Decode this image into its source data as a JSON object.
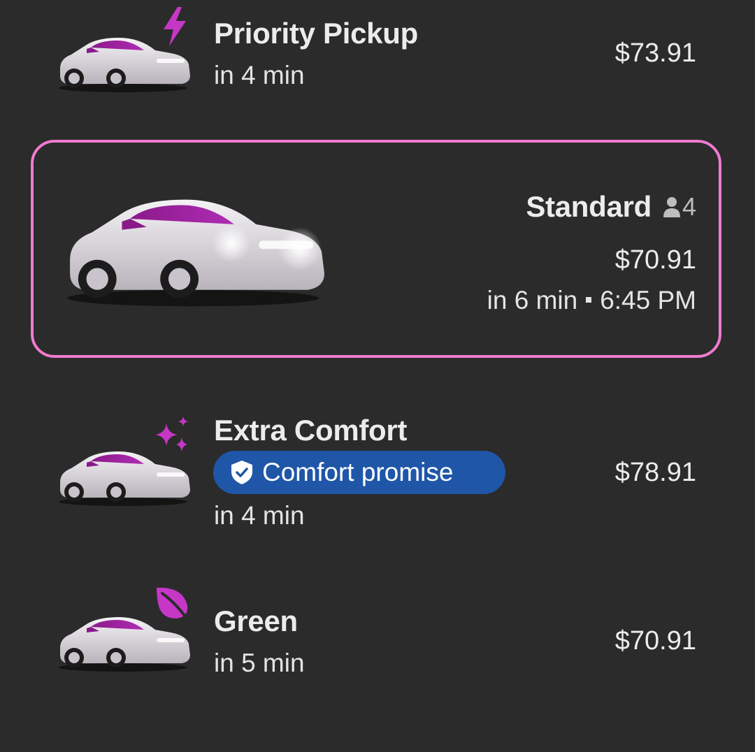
{
  "colors": {
    "background": "#2b2b2b",
    "selected_border": "#f07bcf",
    "accent_magenta": "#c637c6",
    "comfort_badge": "#1f56a8"
  },
  "rides": [
    {
      "name": "Priority Pickup",
      "eta": "in 4 min",
      "price": "$73.91",
      "icon": "lightning-bolt-icon"
    },
    {
      "name": "Standard",
      "seats": "4",
      "price": "$70.91",
      "eta": "in 6 min",
      "arrival": "6:45 PM",
      "selected": true,
      "icon": "person-icon"
    },
    {
      "name": "Extra Comfort",
      "promise": "Comfort promise",
      "eta": "in 4 min",
      "price": "$78.91",
      "icon": "sparkles-icon"
    },
    {
      "name": "Green",
      "eta": "in 5 min",
      "price": "$70.91",
      "icon": "leaf-icon"
    }
  ]
}
